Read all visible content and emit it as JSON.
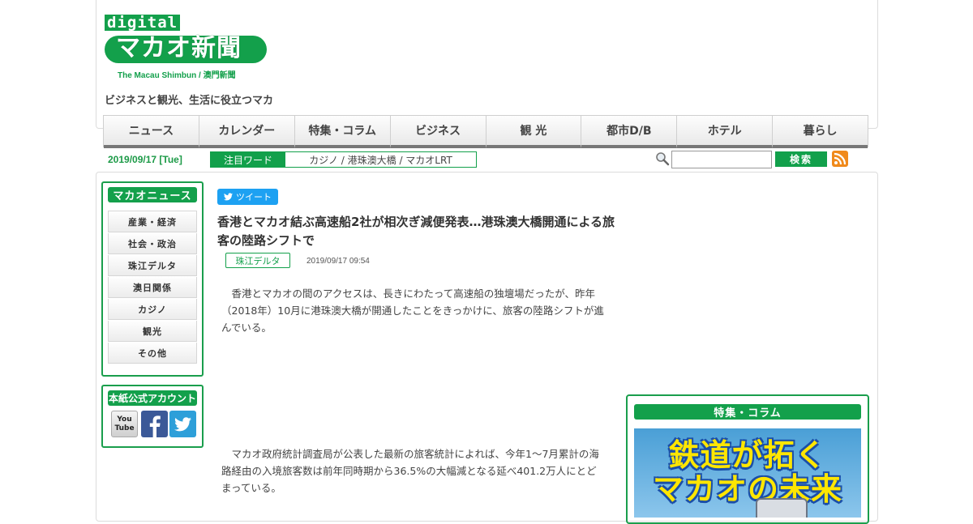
{
  "header": {
    "logo_small": "digital",
    "logo_main": "マカオ新聞",
    "logo_sub": "The Macau Shimbun / 澳門新聞",
    "tagline": "ビジネスと観光、生活に役立つマカ"
  },
  "nav": {
    "items": [
      "ニュース",
      "カレンダー",
      "特集・コラム",
      "ビジネス",
      "観 光",
      "都市D/B",
      "ホテル",
      "暮らし"
    ]
  },
  "infobar": {
    "date": "2019/09/17 [Tue]",
    "hot_label": "注目ワード",
    "hot_words": "カジノ / 港珠澳大橋 / マカオLRT",
    "search_placeholder": "",
    "search_button": "検索"
  },
  "sidebar": {
    "news_title": "マカオニュース",
    "categories": [
      "産業・経済",
      "社会・政治",
      "珠江デルタ",
      "澳日関係",
      "カジノ",
      "観光",
      "その他"
    ],
    "social_title": "本紙公式アカウント",
    "youtube_label": "You Tube"
  },
  "article": {
    "tweet_label": "ツイート",
    "title": "香港とマカオ結ぶ高速船2社が相次ぎ減便発表…港珠澳大橋開通による旅客の陸路シフトで",
    "tag": "珠江デルタ",
    "date": "2019/09/17 09:54",
    "paragraphs": [
      "香港とマカオの間のアクセスは、長きにわたって高速船の独壇場だったが、昨年（2018年）10月に港珠澳大橋が開通したことをきっかけに、旅客の陸路シフトが進んでいる。",
      "マカオ政府統計調査局が公表した最新の旅客統計によれば、今年1〜7月累計の海路経由の入境旅客数は前年同時期から36.5%の大幅減となる延べ401.2万人にとどまっている。"
    ]
  },
  "feature": {
    "title": "特集・コラム",
    "banner_line_1": "鉄道が拓く",
    "banner_line_2": "マカオの未来"
  },
  "colors": {
    "brand_green": "#13a04b",
    "twitter_blue": "#1da1f2",
    "rss_orange": "#f08a1c"
  }
}
